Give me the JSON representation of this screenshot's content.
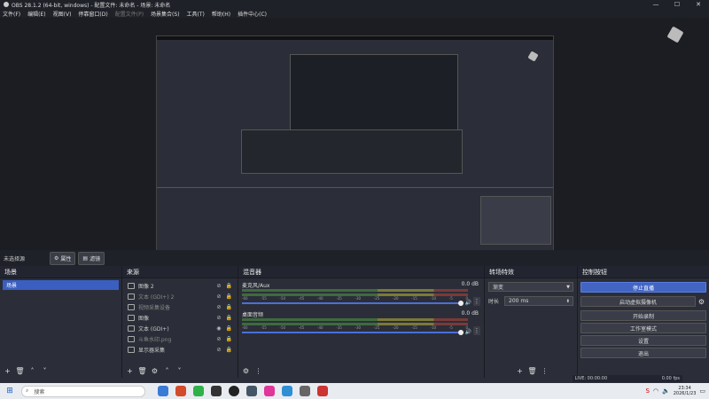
{
  "window": {
    "title": "OBS 28.1.2 (64-bit, windows) - 配置文件: 未命名 - 场景: 未命名",
    "controls": [
      "—",
      "☐",
      "✕"
    ]
  },
  "menu": {
    "items": [
      "文件(F)",
      "编辑(E)",
      "视图(V)",
      "停靠窗口(D)",
      "配置文件(P)",
      "场景集合(S)",
      "工具(T)",
      "帮助(H)",
      "插件中心(C)"
    ]
  },
  "context_bar": {
    "label": "未选择源",
    "properties": "属性",
    "filters": "滤镜"
  },
  "scenes": {
    "title": "场景",
    "items": [
      "场景"
    ]
  },
  "sources": {
    "title": "来源",
    "items": [
      {
        "name": "图像 2",
        "dim": false
      },
      {
        "name": "文本 (GDI+) 2",
        "dim": true
      },
      {
        "name": "视频采集设备",
        "dim": true
      },
      {
        "name": "图像",
        "dim": false
      },
      {
        "name": "文本 (GDI+)",
        "dim": false
      },
      {
        "name": "斗鱼水印.png",
        "dim": true
      },
      {
        "name": "显示器采集",
        "dim": false
      }
    ]
  },
  "mixer": {
    "title": "混音器",
    "channels": [
      {
        "name": "麦克风/Aux",
        "db": "0.0 dB"
      },
      {
        "name": "桌面音频",
        "db": "0.0 dB"
      }
    ],
    "scale": [
      "-60",
      "-55",
      "-50",
      "-45",
      "-40",
      "-35",
      "-30",
      "-25",
      "-20",
      "-15",
      "-10",
      "-5",
      "0"
    ]
  },
  "transitions": {
    "title": "转场特效",
    "selected": "渐变",
    "duration_label": "时长",
    "duration": "200 ms"
  },
  "controls": {
    "title": "控制按钮",
    "buttons": [
      "停止直播",
      "启动虚拟摄像机",
      "开始录制",
      "工作室模式",
      "设置",
      "退出"
    ]
  },
  "status": {
    "live": "LIVE: 00:00:00",
    "fps": "0.00 fps"
  },
  "taskbar": {
    "search": "搜索",
    "time": "23:34",
    "date": "2026/1/23"
  },
  "colors": {
    "accent": "#4265c4",
    "panel": "#2b2e38",
    "title": "#222530"
  }
}
